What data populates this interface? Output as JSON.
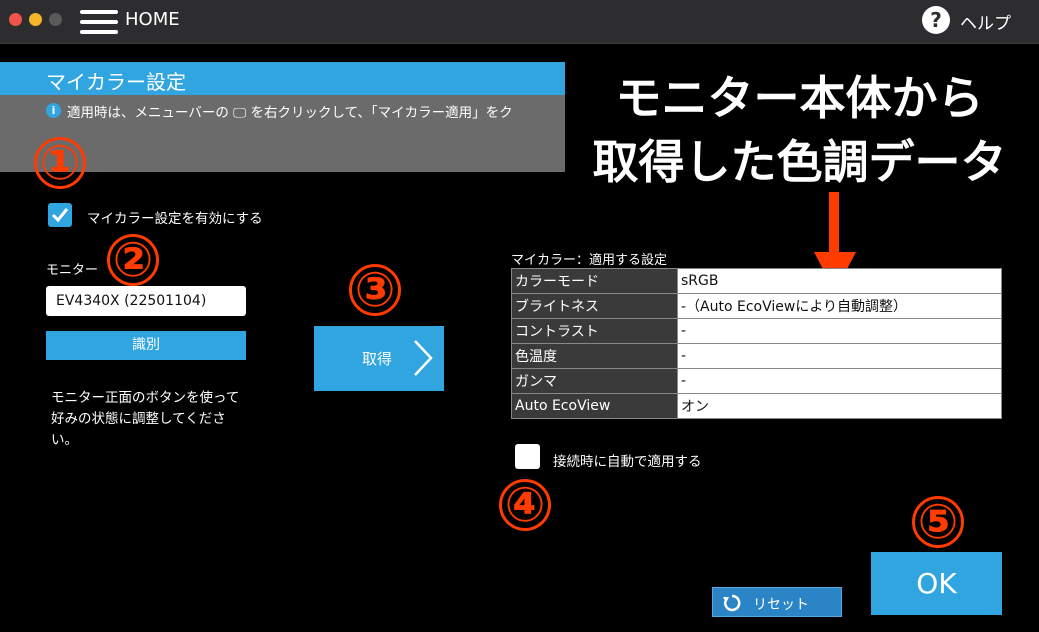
{
  "titlebar": {
    "home_label": "HOME",
    "help_icon": "?",
    "help_label": "ヘルプ"
  },
  "header": {
    "title": "マイカラー設定",
    "info_icon": "i",
    "info_text": "適用時は、メニューバーの 🖵 を右クリックして、「マイカラー適用」をク"
  },
  "overlay": {
    "line1": "モニター本体から",
    "line2": "取得した色調データ"
  },
  "markers": [
    "①",
    "②",
    "③",
    "④",
    "⑤"
  ],
  "enable": {
    "label": "マイカラー設定を有効にする",
    "checked": true
  },
  "monitor": {
    "label": "モニター",
    "selected": "EV4340X (22501104)",
    "identify_label": "識別",
    "hint": "モニター正面のボタンを使って好みの状態に調整してください。"
  },
  "get_button": {
    "label": "取得"
  },
  "settings": {
    "title": "マイカラー：適用する設定",
    "rows": [
      {
        "key": "カラーモード",
        "value": "sRGB"
      },
      {
        "key": "ブライトネス",
        "value": "-（Auto EcoViewにより自動調整）"
      },
      {
        "key": "コントラスト",
        "value": "-"
      },
      {
        "key": "色温度",
        "value": "-"
      },
      {
        "key": "ガンマ",
        "value": "-"
      },
      {
        "key": "Auto EcoView",
        "value": "オン"
      }
    ]
  },
  "auto_apply": {
    "label": "接続時に自動で適用する",
    "checked": false
  },
  "reset": {
    "label": "リセット"
  },
  "ok": {
    "label": "OK"
  },
  "colors": {
    "accent": "#30a5e0",
    "marker": "#ff3b00",
    "titlebar": "#2d2d2f"
  }
}
